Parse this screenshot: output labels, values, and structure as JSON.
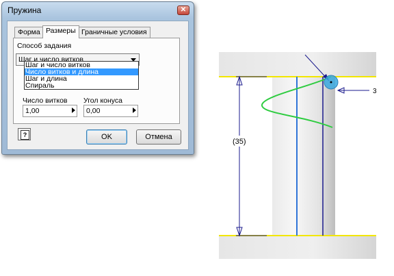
{
  "dialog": {
    "title": "Пружина",
    "close_glyph": "✕",
    "tabs": [
      {
        "label": "Форма",
        "active": false
      },
      {
        "label": "Размеры",
        "active": true
      },
      {
        "label": "Граничные условия",
        "active": false
      }
    ],
    "method_label": "Способ задания",
    "method_value": "Шаг и число витков",
    "method_options": [
      "Шаг и число витков",
      "Число витков и длина",
      "Шаг и длина",
      "Спираль"
    ],
    "method_selected_index": 1,
    "turns_label": "Число витков",
    "turns_value": "1,00",
    "cone_label": "Угол конуса",
    "cone_value": "0,00",
    "help_glyph": "?",
    "ok_label": "OK",
    "cancel_label": "Отмена"
  },
  "drawing": {
    "dimension_label": "(35)",
    "callout_label": "3",
    "colors": {
      "edge_yellow": "#f2e600",
      "dimension_blue": "#1a1a8c",
      "axis_blue": "#2f74d8",
      "spring_green": "#2ecc40",
      "point_cyan": "#39a9e0"
    }
  }
}
